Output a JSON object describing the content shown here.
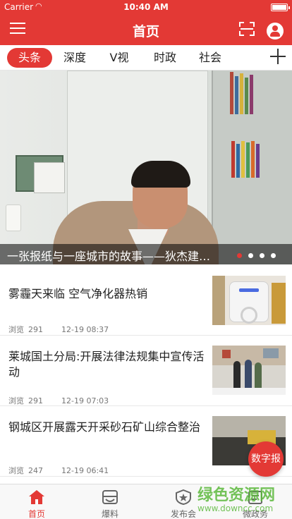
{
  "status_bar": {
    "carrier": "Carrier",
    "time": "10:40 AM"
  },
  "nav": {
    "title": "首页",
    "icons": [
      "menu-icon",
      "scan-icon",
      "user-icon"
    ]
  },
  "tabs": [
    {
      "label": "头条",
      "active": true
    },
    {
      "label": "深度",
      "active": false
    },
    {
      "label": "V视",
      "active": false
    },
    {
      "label": "时政",
      "active": false
    },
    {
      "label": "社会",
      "active": false
    }
  ],
  "banner": {
    "caption": "一张报纸与一座城市的故事——狄杰建…",
    "page_count": 4,
    "active_page": 1
  },
  "news": [
    {
      "title": "雾霾天来临 空气净化器热销",
      "views_label": "浏览",
      "views": "291",
      "time": "12-19 08:37"
    },
    {
      "title": "莱城国土分局:开展法律法规集中宣传活动",
      "views_label": "浏览",
      "views": "291",
      "time": "12-19 07:03"
    },
    {
      "title": "钢城区开展露天开采砂石矿山综合整治",
      "views_label": "浏览",
      "views": "247",
      "time": "12-19 06:41"
    }
  ],
  "fab": {
    "label": "数字报"
  },
  "tabbar": [
    {
      "label": "首页",
      "icon": "home-icon",
      "active": true
    },
    {
      "label": "爆料",
      "icon": "tips-icon",
      "active": false
    },
    {
      "label": "发布会",
      "icon": "badge-icon",
      "active": false
    },
    {
      "label": "微政务",
      "icon": "gov-icon",
      "active": false
    }
  ],
  "watermark": {
    "text": "绿色资源网",
    "url": "www.downcc.com"
  },
  "colors": {
    "brand": "#e33935",
    "text": "#222222",
    "meta": "#777777"
  }
}
